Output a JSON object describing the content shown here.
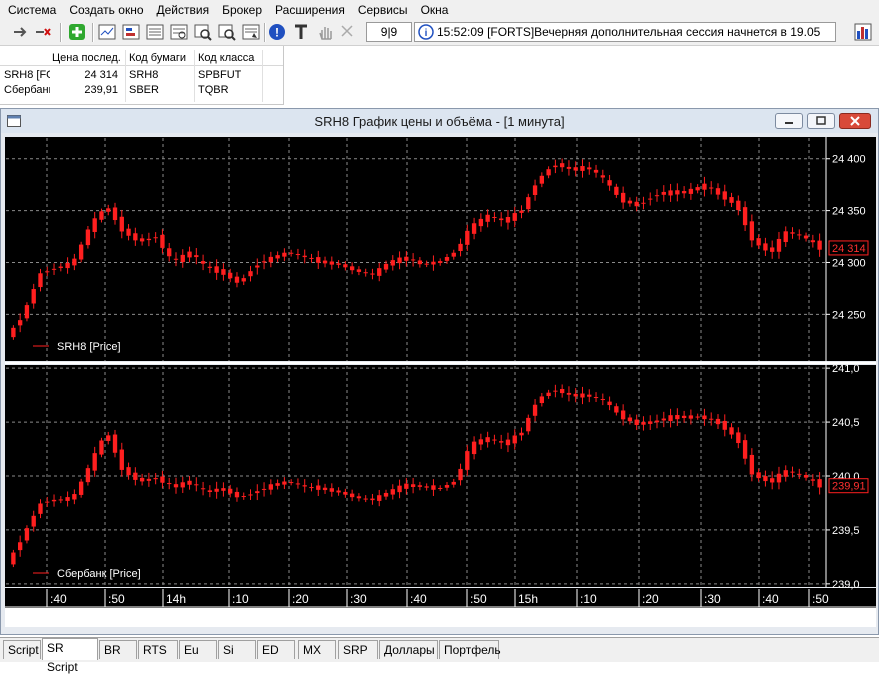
{
  "menu": [
    "Система",
    "Создать окно",
    "Действия",
    "Брокер",
    "Расширения",
    "Сервисы",
    "Окна"
  ],
  "toolbar": {
    "counter": "9|9",
    "status_time": "15:52:09",
    "status_message": "[FORTS]Вечерняя дополнительная сессия начнется в 19.05"
  },
  "quotes_table": {
    "headers": [
      "Цена послед.",
      "Код бумаги",
      "Код класса"
    ],
    "rows": [
      {
        "name": "SRH8 [FO",
        "last": "24 314",
        "code": "SRH8",
        "class": "SPBFUT"
      },
      {
        "name": "Сбербанк",
        "last": "239,91",
        "code": "SBER",
        "class": "TQBR"
      }
    ]
  },
  "chart_window": {
    "title": "SRH8 График цены и объёма - [1 минута]"
  },
  "chart_data": [
    {
      "type": "candlestick",
      "series_label": "SRH8 [Price]",
      "y_ticks": [
        "24 400",
        "24 350",
        "24 300",
        "24 250"
      ],
      "ylim": [
        24205,
        24420
      ],
      "last_label": "24 314",
      "last_value": 24314,
      "color": "#ff1f1f",
      "path": [
        24228,
        24250,
        24290,
        24295,
        24300,
        24335,
        24355,
        24330,
        24320,
        24325,
        24300,
        24310,
        24295,
        24290,
        24280,
        24298,
        24305,
        24310,
        24305,
        24300,
        24298,
        24292,
        24288,
        24300,
        24305,
        24298,
        24300,
        24310,
        24335,
        24345,
        24340,
        24350,
        24380,
        24395,
        24390,
        24392,
        24380,
        24360,
        24355,
        24365,
        24368,
        24368,
        24375,
        24365,
        24355,
        24320,
        24310,
        24330,
        24325,
        24314
      ]
    },
    {
      "type": "candlestick",
      "series_label": "Сбербанк [Price]",
      "y_ticks": [
        "241,0",
        "240,5",
        "240,0",
        "239,5",
        "239,0"
      ],
      "ylim": [
        238.98,
        241.02
      ],
      "last_label": "239,91",
      "last_value": 239.91,
      "color": "#ff1f1f",
      "path": [
        239.18,
        239.45,
        239.75,
        239.78,
        239.8,
        240.1,
        240.42,
        240.05,
        239.95,
        239.98,
        239.9,
        239.95,
        239.85,
        239.88,
        239.8,
        239.85,
        239.92,
        239.95,
        239.9,
        239.88,
        239.85,
        239.8,
        239.78,
        239.85,
        239.92,
        239.9,
        239.88,
        239.95,
        240.3,
        240.35,
        240.3,
        240.4,
        240.72,
        240.8,
        240.75,
        240.75,
        240.7,
        240.55,
        240.48,
        240.5,
        240.55,
        240.55,
        240.55,
        240.48,
        240.35,
        240.0,
        239.95,
        240.05,
        240.0,
        239.91
      ]
    }
  ],
  "time_axis": [
    ":40",
    ":50",
    "14h",
    ":10",
    ":20",
    ":30",
    ":40",
    ":50",
    "15h",
    ":10",
    ":20",
    ":30",
    ":40",
    ":50"
  ],
  "bottom_tabs": [
    "Script",
    "SR Script",
    "BR",
    "RTS",
    "Eu",
    "Si",
    "ED",
    "MX",
    "SRP",
    "Доллары",
    "Портфель"
  ],
  "active_tab": "SR Script"
}
